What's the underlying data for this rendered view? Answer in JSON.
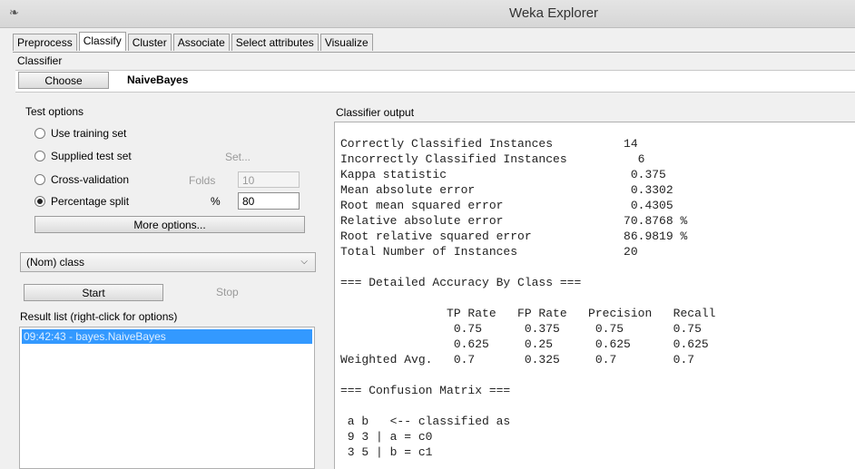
{
  "window": {
    "title": "Weka Explorer",
    "icon": "feather-icon"
  },
  "tabs": [
    {
      "label": "Preprocess"
    },
    {
      "label": "Classify"
    },
    {
      "label": "Cluster"
    },
    {
      "label": "Associate"
    },
    {
      "label": "Select attributes"
    },
    {
      "label": "Visualize"
    }
  ],
  "classifier": {
    "section_label": "Classifier",
    "choose_label": "Choose",
    "name": "NaiveBayes"
  },
  "test_options": {
    "section_label": "Test options",
    "use_training": "Use training set",
    "supplied_test": "Supplied test set",
    "set_label": "Set...",
    "cross_validation": "Cross-validation",
    "folds_label": "Folds",
    "folds_value": "10",
    "percentage_split": "Percentage split",
    "percent_label": "%",
    "percent_value": "80",
    "selected": "percentage_split",
    "more_options": "More options..."
  },
  "class_select": {
    "value": "(Nom) class"
  },
  "run": {
    "start": "Start",
    "stop": "Stop"
  },
  "results": {
    "label": "Result list (right-click for options)",
    "items": [
      "09:42:43 - bayes.NaiveBayes"
    ]
  },
  "output": {
    "label": "Classifier output",
    "lines": [
      "Correctly Classified Instances          14",
      "Incorrectly Classified Instances          6",
      "Kappa statistic                          0.375",
      "Mean absolute error                      0.3302",
      "Root mean squared error                  0.4305",
      "Relative absolute error                 70.8768 %",
      "Root relative squared error             86.9819 %",
      "Total Number of Instances               20",
      "",
      "=== Detailed Accuracy By Class ===",
      "",
      "               TP Rate   FP Rate   Precision   Recall",
      "                0.75      0.375     0.75       0.75",
      "                0.625     0.25      0.625      0.625",
      "Weighted Avg.   0.7       0.325     0.7        0.7",
      "",
      "=== Confusion Matrix ===",
      "",
      " a b   <-- classified as",
      " 9 3 | a = c0",
      " 3 5 | b = c1"
    ]
  }
}
